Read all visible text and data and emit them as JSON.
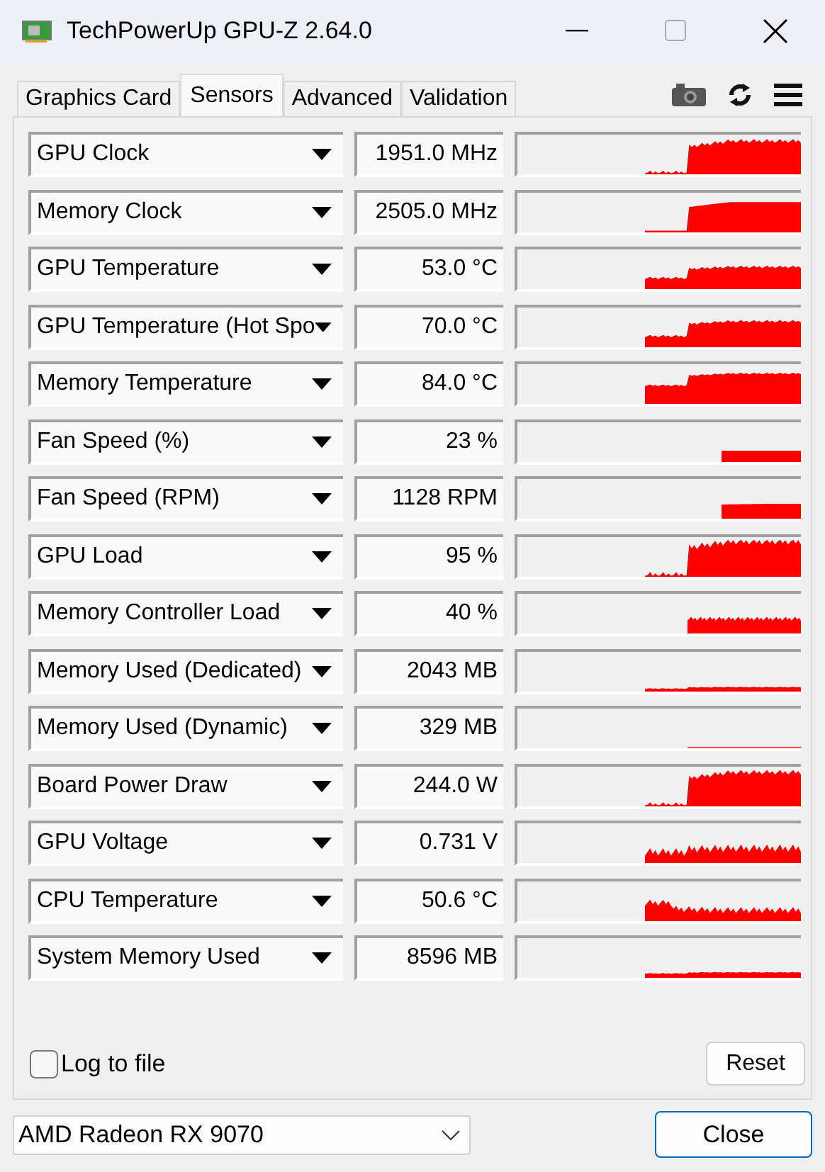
{
  "window": {
    "title": "TechPowerUp GPU-Z 2.64.0"
  },
  "tabs": [
    {
      "label": "Graphics Card",
      "selected": false
    },
    {
      "label": "Sensors",
      "selected": true
    },
    {
      "label": "Advanced",
      "selected": false
    },
    {
      "label": "Validation",
      "selected": false
    }
  ],
  "sensors": [
    {
      "name": "GPU Clock",
      "value": "1951.0 MHz"
    },
    {
      "name": "Memory Clock",
      "value": "2505.0 MHz"
    },
    {
      "name": "GPU Temperature",
      "value": "53.0 °C"
    },
    {
      "name": "GPU Temperature (Hot Spo",
      "value": "70.0 °C"
    },
    {
      "name": "Memory Temperature",
      "value": "84.0 °C"
    },
    {
      "name": "Fan Speed (%)",
      "value": "23 %"
    },
    {
      "name": "Fan Speed (RPM)",
      "value": "1128 RPM"
    },
    {
      "name": "GPU Load",
      "value": "95 %"
    },
    {
      "name": "Memory Controller Load",
      "value": "40 %"
    },
    {
      "name": "Memory Used (Dedicated)",
      "value": "2043 MB"
    },
    {
      "name": "Memory Used (Dynamic)",
      "value": "329 MB"
    },
    {
      "name": "Board Power Draw",
      "value": "244.0 W"
    },
    {
      "name": "GPU Voltage",
      "value": "0.731 V"
    },
    {
      "name": "CPU Temperature",
      "value": "50.6 °C"
    },
    {
      "name": "System Memory Used",
      "value": "8596 MB"
    }
  ],
  "log_to_file": {
    "label": "Log to file",
    "checked": false
  },
  "reset_button": "Reset",
  "device_select": {
    "value": "AMD Radeon RX 9070"
  },
  "close_button": "Close"
}
